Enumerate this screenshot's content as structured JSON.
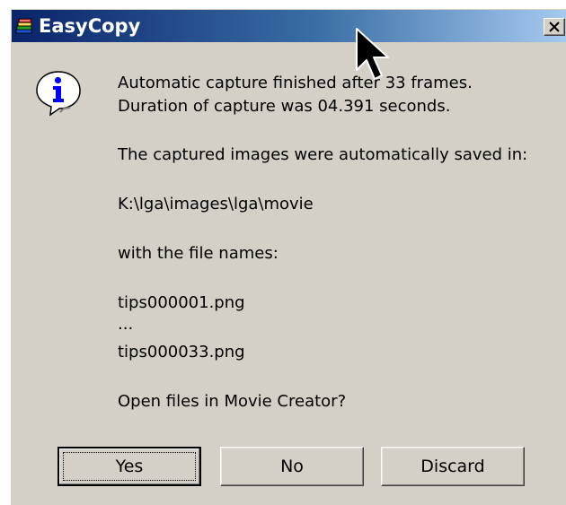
{
  "window": {
    "title": "EasyCopy",
    "close_symbol": "×",
    "app_icon": "books-stack-icon",
    "titlebar_colors": [
      "#0a246a",
      "#a6caf0"
    ]
  },
  "dialog": {
    "icon": "info-icon",
    "lines": [
      "Automatic capture finished after 33 frames.",
      "Duration of capture was 04.391 seconds.",
      "The captured images were automatically saved in:",
      "K:\\lga\\images\\lga\\movie",
      "with the file names:",
      "tips000001.png",
      "...",
      "tips000033.png",
      "Open files in Movie Creator?"
    ]
  },
  "buttons": {
    "yes": "Yes",
    "no": "No",
    "discard": "Discard"
  }
}
